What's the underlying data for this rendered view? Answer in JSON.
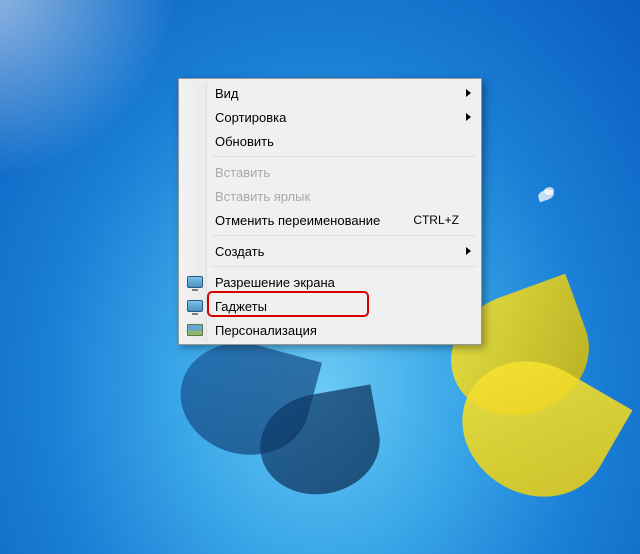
{
  "contextMenu": {
    "view": "Вид",
    "sort": "Сортировка",
    "refresh": "Обновить",
    "paste": "Вставить",
    "pasteShortcut": "Вставить ярлык",
    "undoRename": "Отменить переименование",
    "undoRenameShortcut": "CTRL+Z",
    "new": "Создать",
    "screenResolution": "Разрешение экрана",
    "gadgets": "Гаджеты",
    "personalize": "Персонализация"
  }
}
